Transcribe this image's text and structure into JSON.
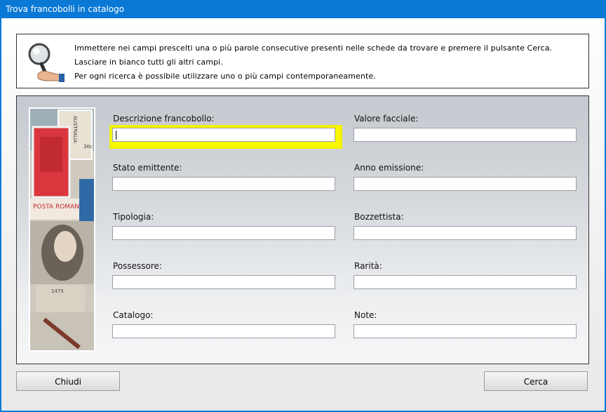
{
  "window": {
    "title": "Trova francobolli in catalogo"
  },
  "info": {
    "lines": [
      "Immettere nei campi prescelti una o più parole consecutive presenti nelle schede da trovare e premere il pulsante Cerca.",
      "Lasciare in bianco tutti gli altri campi.",
      "Per ogni ricerca è possibile utilizzare uno o più campi contemporaneamente."
    ]
  },
  "form": {
    "left": [
      {
        "label": "Descrizione francobollo:",
        "value": ""
      },
      {
        "label": "Stato emittente:",
        "value": ""
      },
      {
        "label": "Tipologia:",
        "value": ""
      },
      {
        "label": "Possessore:",
        "value": ""
      },
      {
        "label": "Catalogo:",
        "value": ""
      }
    ],
    "right": [
      {
        "label": "Valore facciale:",
        "value": ""
      },
      {
        "label": "Anno emissione:",
        "value": ""
      },
      {
        "label": "Bozzettista:",
        "value": ""
      },
      {
        "label": "Rarità:",
        "value": ""
      },
      {
        "label": "Note:",
        "value": ""
      }
    ]
  },
  "stamp_image": {
    "texts": [
      "AUSTRALIA",
      "POSTA ROMANA",
      "1475",
      "30c"
    ]
  },
  "buttons": {
    "close": "Chiudi",
    "search": "Cerca"
  },
  "colors": {
    "titlebar": "#0a79d6",
    "focus": "#f8f800"
  }
}
